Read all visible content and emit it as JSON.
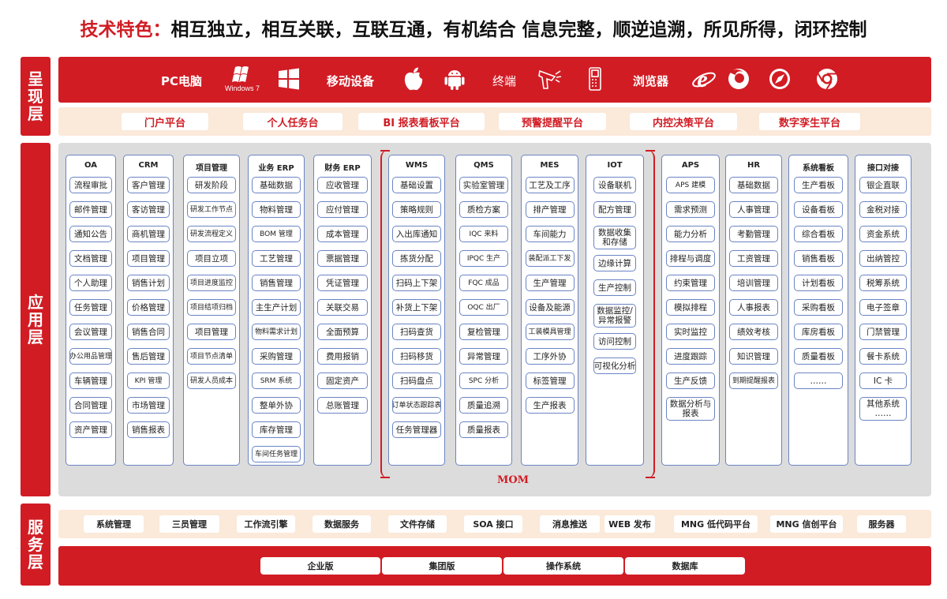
{
  "title": {
    "prefix": "技术特色：",
    "text": "相互独立，相互关联，互联互通，有机结合 信息完整，顺逆追溯，所见所得，闭环控制"
  },
  "colors": {
    "accent": "#d11c24",
    "border": "#6a84c4",
    "pale": "#fbe9d9",
    "gray": "#dcdcdc"
  },
  "layers": {
    "presentation": "呈现层",
    "application": "应用层",
    "service": "服务层"
  },
  "devices": {
    "pc": "PC电脑",
    "windows_caption": "Windows 7",
    "mobile": "移动设备",
    "terminal": "终端",
    "browser": "浏览器"
  },
  "icons": [
    "windows-7-logo-icon",
    "windows-logo-icon",
    "apple-icon",
    "android-icon",
    "scanner-gun-icon",
    "handheld-terminal-icon",
    "ie-browser-icon",
    "firefox-icon",
    "safari-compass-icon",
    "chrome-icon"
  ],
  "platforms": [
    "门户平台",
    "个人任务台",
    "BI 报表看板平台",
    "预警提醒平台",
    "内控决策平台",
    "数字孪生平台"
  ],
  "modules": [
    {
      "title": "OA",
      "items": [
        "流程审批",
        "邮件管理",
        "通知公告",
        "文档管理",
        "个人助理",
        "任务管理",
        "会议管理",
        "办公用品管理",
        "车辆管理",
        "合同管理",
        "资产管理"
      ]
    },
    {
      "title": "CRM",
      "items": [
        "客户管理",
        "客访管理",
        "商机管理",
        "项目管理",
        "销售计划",
        "价格管理",
        "销售合同",
        "售后管理",
        "KPI 管理",
        "市场管理",
        "销售报表"
      ]
    },
    {
      "title": "项目管理",
      "items": [
        "研发阶段",
        "研发工作节点",
        "研发流程定义",
        "项目立项",
        "项目进度监控",
        "项目结项归档",
        "项目管理",
        "项目节点清单",
        "研发人员成本"
      ]
    },
    {
      "title": "业务 ERP",
      "items": [
        "基础数据",
        "物料管理",
        "BOM 管理",
        "工艺管理",
        "销售管理",
        "主生产计划",
        "物料需求计划",
        "采购管理",
        "SRM 系统",
        "整单外协",
        "库存管理",
        "车间任务管理"
      ]
    },
    {
      "title": "财务 ERP",
      "items": [
        "应收管理",
        "应付管理",
        "成本管理",
        "票据管理",
        "凭证管理",
        "关联交易",
        "全面预算",
        "费用报销",
        "固定资产",
        "总账管理"
      ]
    },
    {
      "title": "WMS",
      "items": [
        "基础设置",
        "策略规则",
        "入出库通知",
        "拣货分配",
        "扫码上下架",
        "补货上下架",
        "扫码查货",
        "扫码移货",
        "扫码盘点",
        "订单状态跟踪表",
        "任务管理器"
      ]
    },
    {
      "title": "QMS",
      "items": [
        "实验室管理",
        "质检方案",
        "IQC 来料",
        "IPQC 生产",
        "FQC 成品",
        "OQC 出厂",
        "复检管理",
        "异常管理",
        "SPC 分析",
        "质量追溯",
        "质量报表"
      ]
    },
    {
      "title": "MES",
      "items": [
        "工艺及工序",
        "排产管理",
        "车间能力",
        "装配派工下发",
        "生产管理",
        "设备及能源",
        "工装模具管理",
        "工序外协",
        "标签管理",
        "生产报表"
      ]
    },
    {
      "title": "IOT",
      "items": [
        "设备联机",
        "配方管理",
        "数据收集和存储",
        "边缘计算",
        "生产控制",
        "数据监控/异常报警",
        "访问控制",
        "可视化分析"
      ]
    },
    {
      "title": "APS",
      "items": [
        "APS 建模",
        "需求预测",
        "能力分析",
        "排程与调度",
        "约束管理",
        "模拟排程",
        "实时监控",
        "进度跟踪",
        "生产反馈",
        "数据分析与报表"
      ]
    },
    {
      "title": "HR",
      "items": [
        "基础数据",
        "人事管理",
        "考勤管理",
        "工资管理",
        "培训管理",
        "人事报表",
        "绩效考核",
        "知识管理",
        "到期提醒报表"
      ]
    },
    {
      "title": "系统看板",
      "items": [
        "生产看板",
        "设备看板",
        "综合看板",
        "销售看板",
        "计划看板",
        "采购看板",
        "库房看板",
        "质量看板",
        "……"
      ]
    },
    {
      "title": "接口对接",
      "items": [
        "银企直联",
        "金税对接",
        "资金系统",
        "出纳管控",
        "税筹系统",
        "电子签章",
        "门禁管理",
        "餐卡系统",
        "IC 卡",
        "其他系统 ……"
      ]
    }
  ],
  "mom_label": "MOM",
  "services": [
    "系统管理",
    "三员管理",
    "工作流引擎",
    "数据服务",
    "文件存储",
    "SOA 接口",
    "消息推送",
    "WEB 发布",
    "MNG 低代码平台",
    "MNG 信创平台",
    "服务器"
  ],
  "bases": [
    "企业版",
    "集团版",
    "操作系统",
    "数据库"
  ]
}
